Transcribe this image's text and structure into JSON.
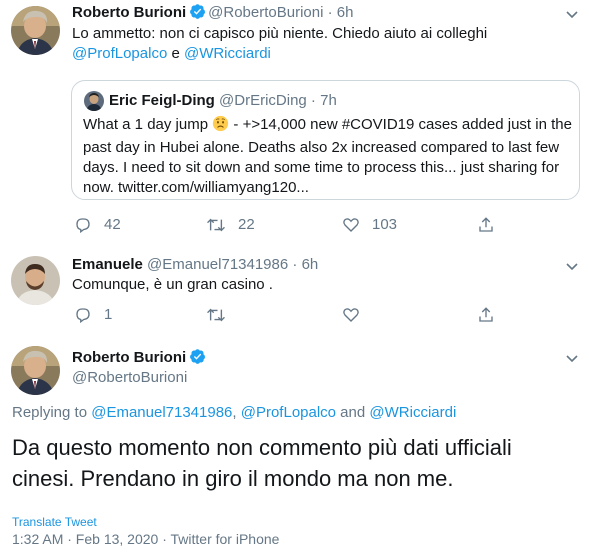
{
  "tweet1": {
    "name": "Roberto Burioni",
    "handle": "@RobertoBurioni",
    "time": "6h",
    "text_line1": "Lo ammetto: non ci capisco più niente. Chiedo aiuto ai colleghi",
    "mention1": "@ProfLopalco",
    "conj": " e ",
    "mention2": "@WRicciardi",
    "quote": {
      "name": "Eric Feigl-Ding",
      "handle": "@DrEricDing",
      "time": "7h",
      "line1_a": "What a 1 day jump",
      "line1_b": " - +>14,000 new #COVID19 cases added just in the",
      "line2": "past day in Hubei alone. Deaths also 2x increased compared to last few",
      "line3": "days. I need to sit down and some time to process this... just sharing for",
      "line4": "now. twitter.com/williamyang120..."
    },
    "replies": "42",
    "retweets": "22",
    "likes": "103"
  },
  "tweet2": {
    "name": "Emanuele",
    "handle": "@Emanuel71341986",
    "time": "6h",
    "text": "Comunque, è un gran casino .",
    "replies": "1"
  },
  "main": {
    "name": "Roberto Burioni",
    "handle": "@RobertoBurioni",
    "replying_prefix": "Replying to ",
    "replying_m1": "@Emanuel71341986",
    "replying_m2": "@ProfLopalco",
    "replying_and": " and ",
    "replying_m3": "@WRicciardi",
    "text_line1": "Da questo momento non commento più dati ufficiali",
    "text_line2": "cinesi. Prendano in giro il mondo ma non me.",
    "translate": "Translate Tweet",
    "timestamp": "1:32 AM · Feb 13, 2020 · ",
    "source": "Twitter for iPhone"
  },
  "icons": {
    "verified": "verified-badge-icon",
    "reply": "reply-icon",
    "retweet": "retweet-icon",
    "like": "heart-icon",
    "share": "share-icon",
    "more": "chevron-down-icon",
    "worried": "worried-face-emoji"
  },
  "colors": {
    "link": "#1b95e0",
    "secondary": "#657786",
    "border": "#ccd6dd"
  }
}
